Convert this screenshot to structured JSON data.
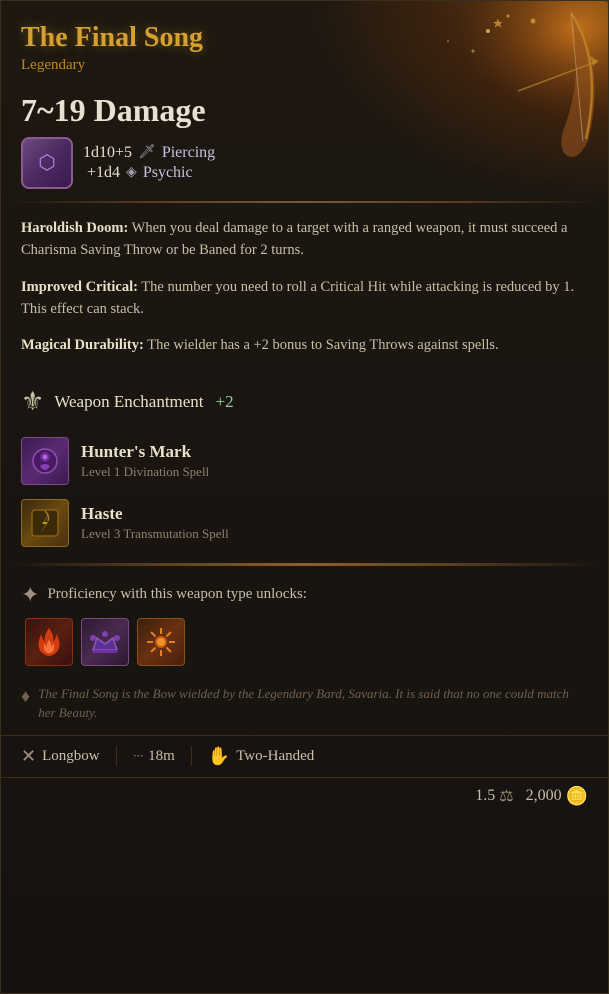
{
  "card": {
    "title": "The Final Song",
    "rarity": "Legendary",
    "damage": {
      "range": "7~19 Damage",
      "line1_dice": "1d10+5",
      "line1_icon": "🗡",
      "line1_type": "Piercing",
      "line2_dice": "+1d4",
      "line2_icon": "◈",
      "line2_type": "Psychic"
    },
    "properties": [
      {
        "name": "Haroldish Doom:",
        "text": "When you deal damage to a target with a ranged weapon, it must succeed a Charisma Saving Throw or be Baned for 2 turns."
      },
      {
        "name": "Improved Critical:",
        "text": "The number you need to roll a Critical Hit while attacking is reduced by 1. This effect can stack."
      },
      {
        "name": "Magical Durability:",
        "text": "The wielder has a +2 bonus to Saving Throws against spells."
      }
    ],
    "enchantment": {
      "label": "Weapon Enchantment",
      "bonus": "+2"
    },
    "spells": [
      {
        "name": "Hunter's Mark",
        "subtext": "Level 1 Divination Spell",
        "type": "hunters"
      },
      {
        "name": "Haste",
        "subtext": "Level 3 Transmutation Spell",
        "type": "haste"
      }
    ],
    "proficiency": {
      "label": "Proficiency with this weapon type unlocks:",
      "icons": [
        "fire",
        "crown",
        "burst"
      ]
    },
    "flavor": {
      "text": "The Final Song is the Bow wielded by the Legendary Bard, Savaria. It is said that no one could match her Beauty."
    },
    "stats": [
      {
        "icon": "⚔",
        "label": "Longbow"
      },
      {
        "icon": "···",
        "label": "18m"
      },
      {
        "icon": "✋",
        "label": "Two-Handed"
      }
    ],
    "weight": "1.5",
    "gold": "2,000"
  }
}
